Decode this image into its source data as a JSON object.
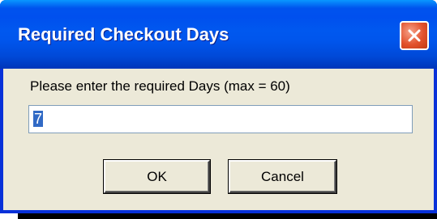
{
  "window": {
    "title": "Required Checkout Days",
    "close_icon": "close-icon"
  },
  "colors": {
    "titlebar_start": "#0997ff",
    "titlebar_end": "#0036b9",
    "dialog_background": "#ece9d8",
    "close_button": "#e2512c",
    "selection": "#316ac5"
  },
  "prompt": {
    "label": "Please enter the required Days (max = 60)"
  },
  "days_input": {
    "value": "7"
  },
  "buttons": {
    "ok_label": "OK",
    "cancel_label": "Cancel"
  }
}
